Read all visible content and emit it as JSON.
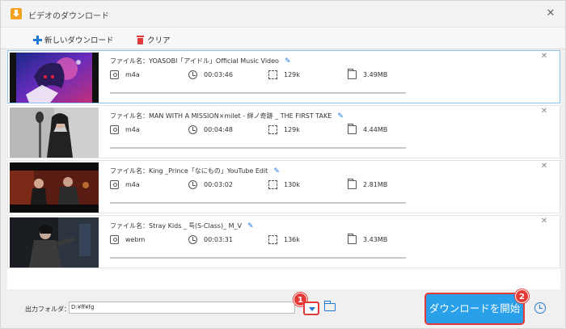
{
  "window": {
    "title": "ビデオのダウンロード",
    "close_symbol": "✕"
  },
  "toolbar": {
    "new_download_label": "新しいダウンロード",
    "clear_label": "クリア"
  },
  "items": [
    {
      "filename": "ファイル名：YOASOBI「アイドル」Official Music Video",
      "format": "m4a",
      "duration": "00:03:46",
      "bitrate": "129k",
      "size": "3.49MB",
      "selected": true,
      "progress": 0
    },
    {
      "filename": "ファイル名：MAN WITH A MISSION×milet - 絆ノ奇跡 _ THE FIRST TAKE",
      "format": "m4a",
      "duration": "00:04:48",
      "bitrate": "129k",
      "size": "4.44MB",
      "selected": false,
      "progress": 0
    },
    {
      "filename": "ファイル名：King _Prince「なにもの」YouTube Edit",
      "format": "m4a",
      "duration": "00:03:02",
      "bitrate": "130k",
      "size": "2.81MB",
      "selected": false,
      "progress": 0
    },
    {
      "filename": "ファイル名：Stray Kids _ 특(S-Class)_ M_V",
      "format": "webm",
      "duration": "00:03:31",
      "bitrate": "136k",
      "size": "3.43MB",
      "selected": false,
      "progress": 0
    }
  ],
  "item_close_symbol": "✕",
  "edit_symbol": "✎",
  "bottom": {
    "output_label": "出力フォルダ：",
    "output_value": "D:¥ff¥fg",
    "start_label": "ダウンロードを開始",
    "badge_1": "1",
    "badge_2": "2"
  },
  "colors": {
    "accent": "#1e7ad6",
    "start_button": "#2aa0ea",
    "highlight": "#e53935",
    "selected_border": "#8cc4ee"
  }
}
